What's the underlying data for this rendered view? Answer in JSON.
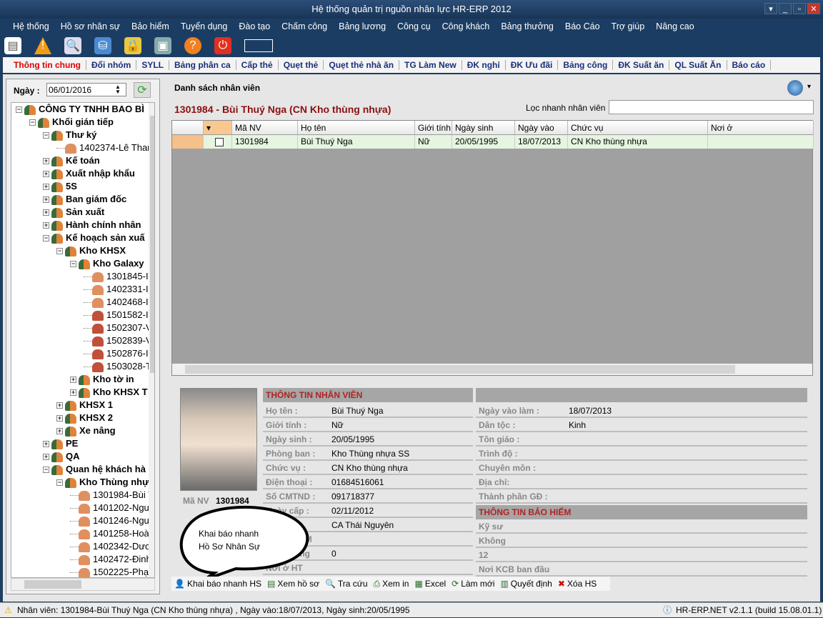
{
  "window": {
    "title": "Hệ thống quản trị nguồn nhân lực HR-ERP 2012"
  },
  "menu": [
    "Hệ thống",
    "Hồ sơ nhân sự",
    "Bảo hiểm",
    "Tuyển dụng",
    "Đào tạo",
    "Chấm công",
    "Bảng lương",
    "Công cụ",
    "Công khách",
    "Bảng thưởng",
    "Báo Cáo",
    "Trợ giúp",
    "Nâng cao"
  ],
  "toolbar_icons": [
    "new-document-icon",
    "warning-icon",
    "preview-icon",
    "network-icon",
    "lock-icon",
    "image-icon",
    "help-icon",
    "power-icon"
  ],
  "tabs": [
    "Thông tin chung",
    "Đổi nhóm",
    "SYLL",
    "Bảng phân ca",
    "Cấp thẻ",
    "Quẹt thẻ",
    "Quẹt thẻ nhà ăn",
    "TG Làm New",
    "ĐK nghỉ",
    "ĐK Ưu đãi",
    "Bảng công",
    "ĐK Suất ăn",
    "QL Suất Ăn",
    "Báo cáo"
  ],
  "active_tab": "Thông tin chung",
  "left": {
    "date_label": "Ngày :",
    "date_value": "06/01/2016",
    "tree": [
      {
        "t": "CÔNG TY TNHH BAO BÌ",
        "l": 0,
        "e": "-",
        "k": "g"
      },
      {
        "t": "Khối gián tiếp",
        "l": 1,
        "e": "-",
        "k": "g"
      },
      {
        "t": "Thư ký",
        "l": 2,
        "e": "-",
        "k": "g"
      },
      {
        "t": "1402374-Lê Thar",
        "l": 3,
        "e": "",
        "k": "p"
      },
      {
        "t": "Kế toán",
        "l": 2,
        "e": "+",
        "k": "g"
      },
      {
        "t": "Xuất nhập khẩu",
        "l": 2,
        "e": "+",
        "k": "g"
      },
      {
        "t": "5S",
        "l": 2,
        "e": "+",
        "k": "g"
      },
      {
        "t": "Ban giám đốc",
        "l": 2,
        "e": "+",
        "k": "g"
      },
      {
        "t": "Sản xuất",
        "l": 2,
        "e": "+",
        "k": "g"
      },
      {
        "t": "Hành chính nhân",
        "l": 2,
        "e": "+",
        "k": "g"
      },
      {
        "t": "Kế hoạch sản xuấ",
        "l": 2,
        "e": "-",
        "k": "g"
      },
      {
        "t": "Kho KHSX",
        "l": 3,
        "e": "-",
        "k": "g"
      },
      {
        "t": "Kho Galaxy",
        "l": 4,
        "e": "-",
        "k": "g"
      },
      {
        "t": "1301845-I",
        "l": 5,
        "e": "",
        "k": "p"
      },
      {
        "t": "1402331-I",
        "l": 5,
        "e": "",
        "k": "p"
      },
      {
        "t": "1402468-I",
        "l": 5,
        "e": "",
        "k": "p"
      },
      {
        "t": "1501582-I",
        "l": 5,
        "e": "",
        "k": "p2"
      },
      {
        "t": "1502307-V",
        "l": 5,
        "e": "",
        "k": "p2"
      },
      {
        "t": "1502839-V",
        "l": 5,
        "e": "",
        "k": "p2"
      },
      {
        "t": "1502876-I",
        "l": 5,
        "e": "",
        "k": "p2"
      },
      {
        "t": "1503028-T",
        "l": 5,
        "e": "",
        "k": "p2"
      },
      {
        "t": "Kho tờ in",
        "l": 4,
        "e": "+",
        "k": "g"
      },
      {
        "t": "Kho KHSX T",
        "l": 4,
        "e": "+",
        "k": "g"
      },
      {
        "t": "KHSX 1",
        "l": 3,
        "e": "+",
        "k": "g"
      },
      {
        "t": "KHSX 2",
        "l": 3,
        "e": "+",
        "k": "g"
      },
      {
        "t": "Xe nâng",
        "l": 3,
        "e": "+",
        "k": "g"
      },
      {
        "t": "PE",
        "l": 2,
        "e": "+",
        "k": "g"
      },
      {
        "t": "QA",
        "l": 2,
        "e": "+",
        "k": "g"
      },
      {
        "t": "Quan hệ khách hà",
        "l": 2,
        "e": "-",
        "k": "g"
      },
      {
        "t": "Kho Thùng nhự",
        "l": 3,
        "e": "-",
        "k": "g"
      },
      {
        "t": "1301984-Bùi T",
        "l": 4,
        "e": "",
        "k": "p"
      },
      {
        "t": "1401202-Ngu",
        "l": 4,
        "e": "",
        "k": "p"
      },
      {
        "t": "1401246-Ngu",
        "l": 4,
        "e": "",
        "k": "p"
      },
      {
        "t": "1401258-Hoà",
        "l": 4,
        "e": "",
        "k": "p"
      },
      {
        "t": "1402342-Dươ",
        "l": 4,
        "e": "",
        "k": "p"
      },
      {
        "t": "1402472-Đinh",
        "l": 4,
        "e": "",
        "k": "p"
      },
      {
        "t": "1502225-Phạ",
        "l": 4,
        "e": "",
        "k": "p"
      }
    ]
  },
  "right": {
    "panel_title": "Danh sách nhân viên",
    "employee_heading": "1301984 - Bùi Thuý Nga (CN Kho thùng nhựa)",
    "filter_label": "Lọc nhanh nhân viên",
    "filter_value": "",
    "columns": [
      "Mã NV",
      "Họ tên",
      "Giới tính",
      "Ngày sinh",
      "Ngày vào",
      "Chức vụ",
      "Nơi ở"
    ],
    "rows": [
      [
        "1301984",
        "Bùi Thuý Nga",
        "Nữ",
        "20/05/1995",
        "18/07/2013",
        "CN Kho thùng nhựa",
        ""
      ]
    ],
    "photo_id_label": "Mã NV",
    "photo_id_value": "1301984",
    "section_employee": "THÔNG TIN NHÂN VIÊN",
    "section_insurance": "THÔNG TIN BẢO HIỂM",
    "info_left": [
      [
        "Họ tên :",
        "Bùi Thuý Nga"
      ],
      [
        "Giới tính :",
        "Nữ"
      ],
      [
        "Ngày sinh :",
        "20/05/1995"
      ],
      [
        "Phòng ban :",
        "Kho Thùng nhựa SS"
      ],
      [
        "Chức vụ :",
        "CN Kho thùng nhựa"
      ],
      [
        "Điện thoại :",
        "01684516061"
      ],
      [
        "Số CMTND :",
        "091718377"
      ],
      [
        "Ngày cấp :",
        "02/11/2012"
      ],
      [
        "Nơi cấp",
        "CA Thái Nguyên"
      ],
      [
        "Số thẻ ATM",
        ""
      ],
      [
        "Ngân hàng",
        "0"
      ],
      [
        "Nơi ở HT",
        ""
      ]
    ],
    "info_right": [
      [
        "Ngày vào làm :",
        "18/07/2013"
      ],
      [
        "Dân tộc :",
        "Kinh"
      ],
      [
        "Tôn giáo :",
        ""
      ],
      [
        "Trình độ :",
        ""
      ],
      [
        "Chuyên môn :",
        ""
      ],
      [
        "Địa chỉ:",
        ""
      ],
      [
        "Thành phần GĐ :",
        ""
      ]
    ],
    "insurance": [
      "Kỹ sư",
      "Không",
      "12",
      "Nơi KCB ban đầu"
    ],
    "callout": [
      "Khai báo nhanh",
      "Hồ Sơ Nhân Sự"
    ],
    "actions": [
      "Khai báo nhanh HS",
      "Xem hồ sơ",
      "Tra cứu",
      "Xem in",
      "Excel",
      "Làm mới",
      "Quyết định",
      "Xóa HS"
    ]
  },
  "status": {
    "left": "Nhân viên: 1301984-Bùi Thuý Nga (CN Kho thùng nhựa) , Ngày vào:18/07/2013, Ngày sinh:20/05/1995",
    "right": "HR-ERP.NET v2.1.1 (build 15.08.01.1)"
  }
}
